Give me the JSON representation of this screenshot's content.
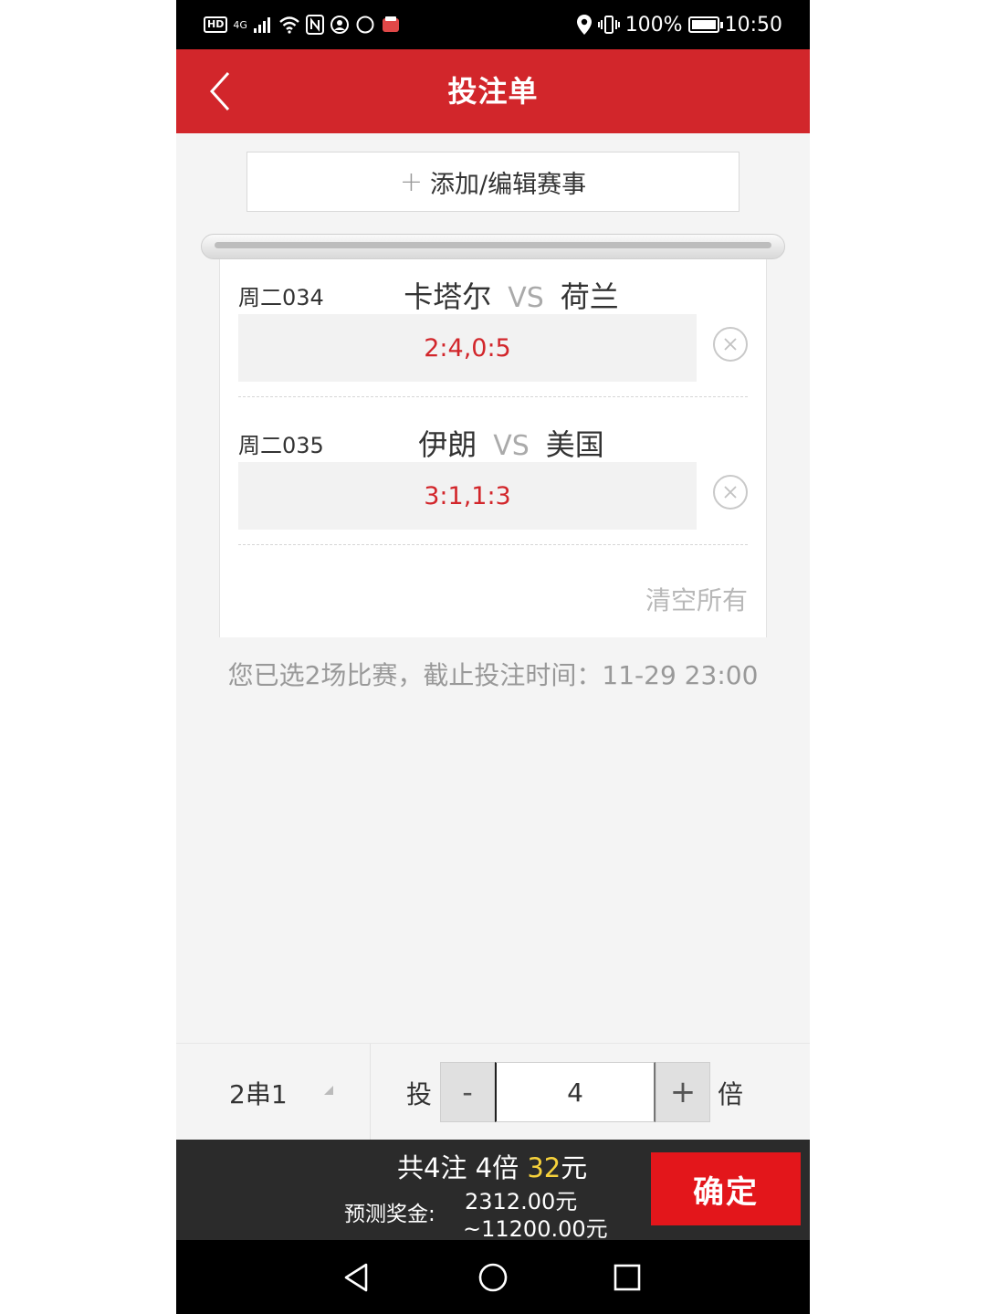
{
  "statusbar": {
    "network": "4G",
    "battery_text": "100%",
    "battery_level": 1.0,
    "time": "10:50"
  },
  "header": {
    "title": "投注单",
    "back_icon": "chevron-left-icon"
  },
  "add_button": {
    "label": "添加/编辑赛事",
    "icon": "plus-icon"
  },
  "matches": [
    {
      "code": "周二034",
      "home": "卡塔尔",
      "vs": "VS",
      "away": "荷兰",
      "selection": "2:4,0:5"
    },
    {
      "code": "周二035",
      "home": "伊朗",
      "vs": "VS",
      "away": "美国",
      "selection": "3:1,1:3"
    }
  ],
  "clear_all": "清空所有",
  "info_line": "您已选2场比赛，截止投注时间：11-29 23:00",
  "options": {
    "pass_type": "2串1",
    "tou_label": "投",
    "minus_label": "-",
    "multiplier": "4",
    "plus_label": "+",
    "bei_label": "倍"
  },
  "summary": {
    "prefix": "共4注 4倍 ",
    "amount": "32",
    "suffix": "元",
    "prize_label": "预测奖金:",
    "prize_min": "2312.00元",
    "prize_max": "~11200.00元",
    "confirm_label": "确定"
  },
  "colors": {
    "header_red": "#d2262b",
    "selection_red": "#d2262b",
    "highlight_yellow": "#f7d23b",
    "confirm_red": "#e3161b"
  }
}
